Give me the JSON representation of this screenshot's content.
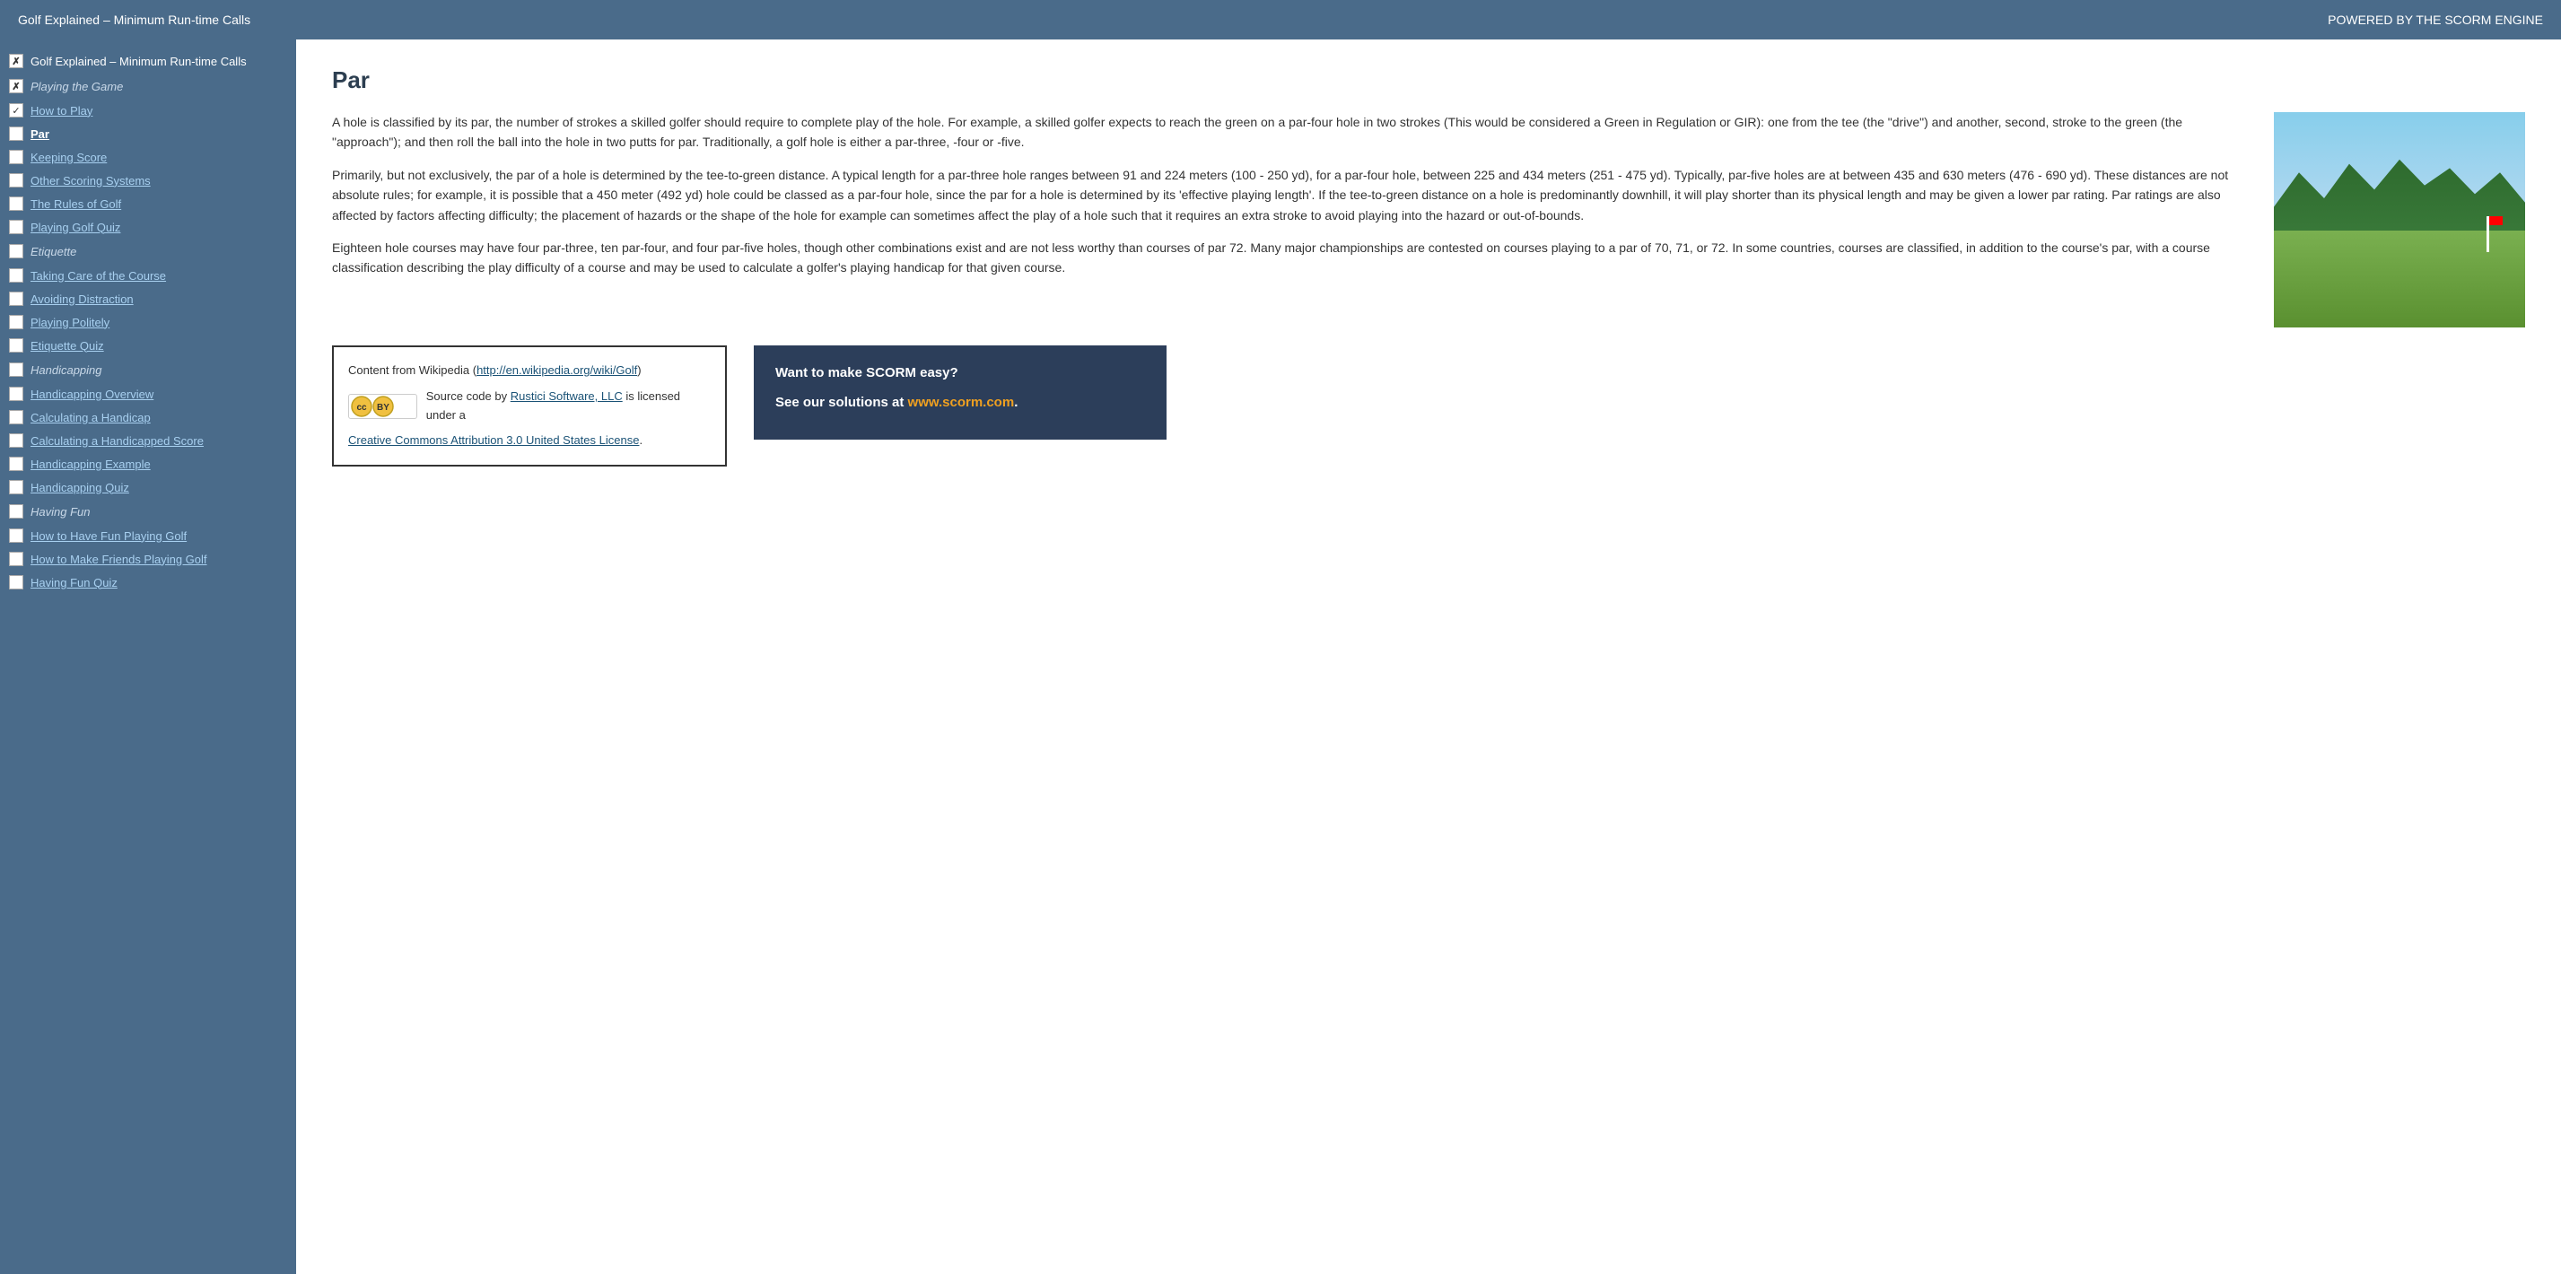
{
  "header": {
    "title": "Golf Explained – Minimum Run-time Calls",
    "powered_by": "POWERED BY THE SCORM ENGINE"
  },
  "sidebar": {
    "root_label": "Golf Explained – Minimum Run-time Calls",
    "root_status": "ex",
    "sections": [
      {
        "label": "Playing the Game",
        "status": "ex",
        "items": [
          {
            "label": "How to Play",
            "status": "checked",
            "active": false
          },
          {
            "label": "Par",
            "status": "",
            "active": true
          },
          {
            "label": "Keeping Score",
            "status": "",
            "active": false
          },
          {
            "label": "Other Scoring Systems",
            "status": "",
            "active": false
          },
          {
            "label": "The Rules of Golf",
            "status": "",
            "active": false
          },
          {
            "label": "Playing Golf Quiz",
            "status": "",
            "active": false
          }
        ]
      },
      {
        "label": "Etiquette",
        "status": "",
        "items": [
          {
            "label": "Taking Care of the Course",
            "status": "",
            "active": false
          },
          {
            "label": "Avoiding Distraction",
            "status": "",
            "active": false
          },
          {
            "label": "Playing Politely",
            "status": "",
            "active": false
          },
          {
            "label": "Etiquette Quiz",
            "status": "",
            "active": false
          }
        ]
      },
      {
        "label": "Handicapping",
        "status": "",
        "items": [
          {
            "label": "Handicapping Overview",
            "status": "",
            "active": false
          },
          {
            "label": "Calculating a Handicap",
            "status": "",
            "active": false
          },
          {
            "label": "Calculating a Handicapped Score",
            "status": "",
            "active": false
          },
          {
            "label": "Handicapping Example",
            "status": "",
            "active": false
          },
          {
            "label": "Handicapping Quiz",
            "status": "",
            "active": false
          }
        ]
      },
      {
        "label": "Having Fun",
        "status": "",
        "items": [
          {
            "label": "How to Have Fun Playing Golf",
            "status": "",
            "active": false
          },
          {
            "label": "How to Make Friends Playing Golf",
            "status": "",
            "active": false
          },
          {
            "label": "Having Fun Quiz",
            "status": "",
            "active": false
          }
        ]
      }
    ]
  },
  "main": {
    "title": "Par",
    "paragraphs": [
      "A hole is classified by its par, the number of strokes a skilled golfer should require to complete play of the hole. For example, a skilled golfer expects to reach the green on a par-four hole in two strokes (This would be considered a Green in Regulation or GIR): one from the tee (the \"drive\") and another, second, stroke to the green (the \"approach\"); and then roll the ball into the hole in two putts for par. Traditionally, a golf hole is either a par-three, -four or -five.",
      "Primarily, but not exclusively, the par of a hole is determined by the tee-to-green distance. A typical length for a par-three hole ranges between 91 and 224 meters (100 - 250 yd), for a par-four hole, between 225 and 434 meters (251 - 475 yd). Typically, par-five holes are at between 435 and 630 meters (476 - 690 yd). These distances are not absolute rules; for example, it is possible that a 450 meter (492 yd) hole could be classed as a par-four hole, since the par for a hole is determined by its 'effective playing length'. If the tee-to-green distance on a hole is predominantly downhill, it will play shorter than its physical length and may be given a lower par rating. Par ratings are also affected by factors affecting difficulty; the placement of hazards or the shape of the hole for example can sometimes affect the play of a hole such that it requires an extra stroke to avoid playing into the hazard or out-of-bounds.",
      "Eighteen hole courses may have four par-three, ten par-four, and four par-five holes, though other combinations exist and are not less worthy than courses of par 72. Many major championships are contested on courses playing to a par of 70, 71, or 72. In some countries, courses are classified, in addition to the course's par, with a course classification describing the play difficulty of a course and may be used to calculate a golfer's playing handicap for that given course."
    ],
    "wiki_box": {
      "prefix": "Content from Wikipedia (",
      "url": "http://en.wikipedia.org/wiki/Golf",
      "url_label": "http://en.wikipedia.org/wiki/Golf",
      "suffix": ")",
      "source_text": "Source code by ",
      "source_link_label": "Rustici Software, LLC",
      "source_link_url": "#",
      "license_text": "is licensed under a",
      "license_link_label": "Creative Commons Attribution 3.0 United States License",
      "license_link_url": "#",
      "period": "."
    },
    "scorm_box": {
      "line1": "Want to make SCORM easy?",
      "line2_prefix": "See our solutions at ",
      "link_label": "www.scorm.com",
      "link_url": "http://www.scorm.com",
      "period": "."
    }
  }
}
